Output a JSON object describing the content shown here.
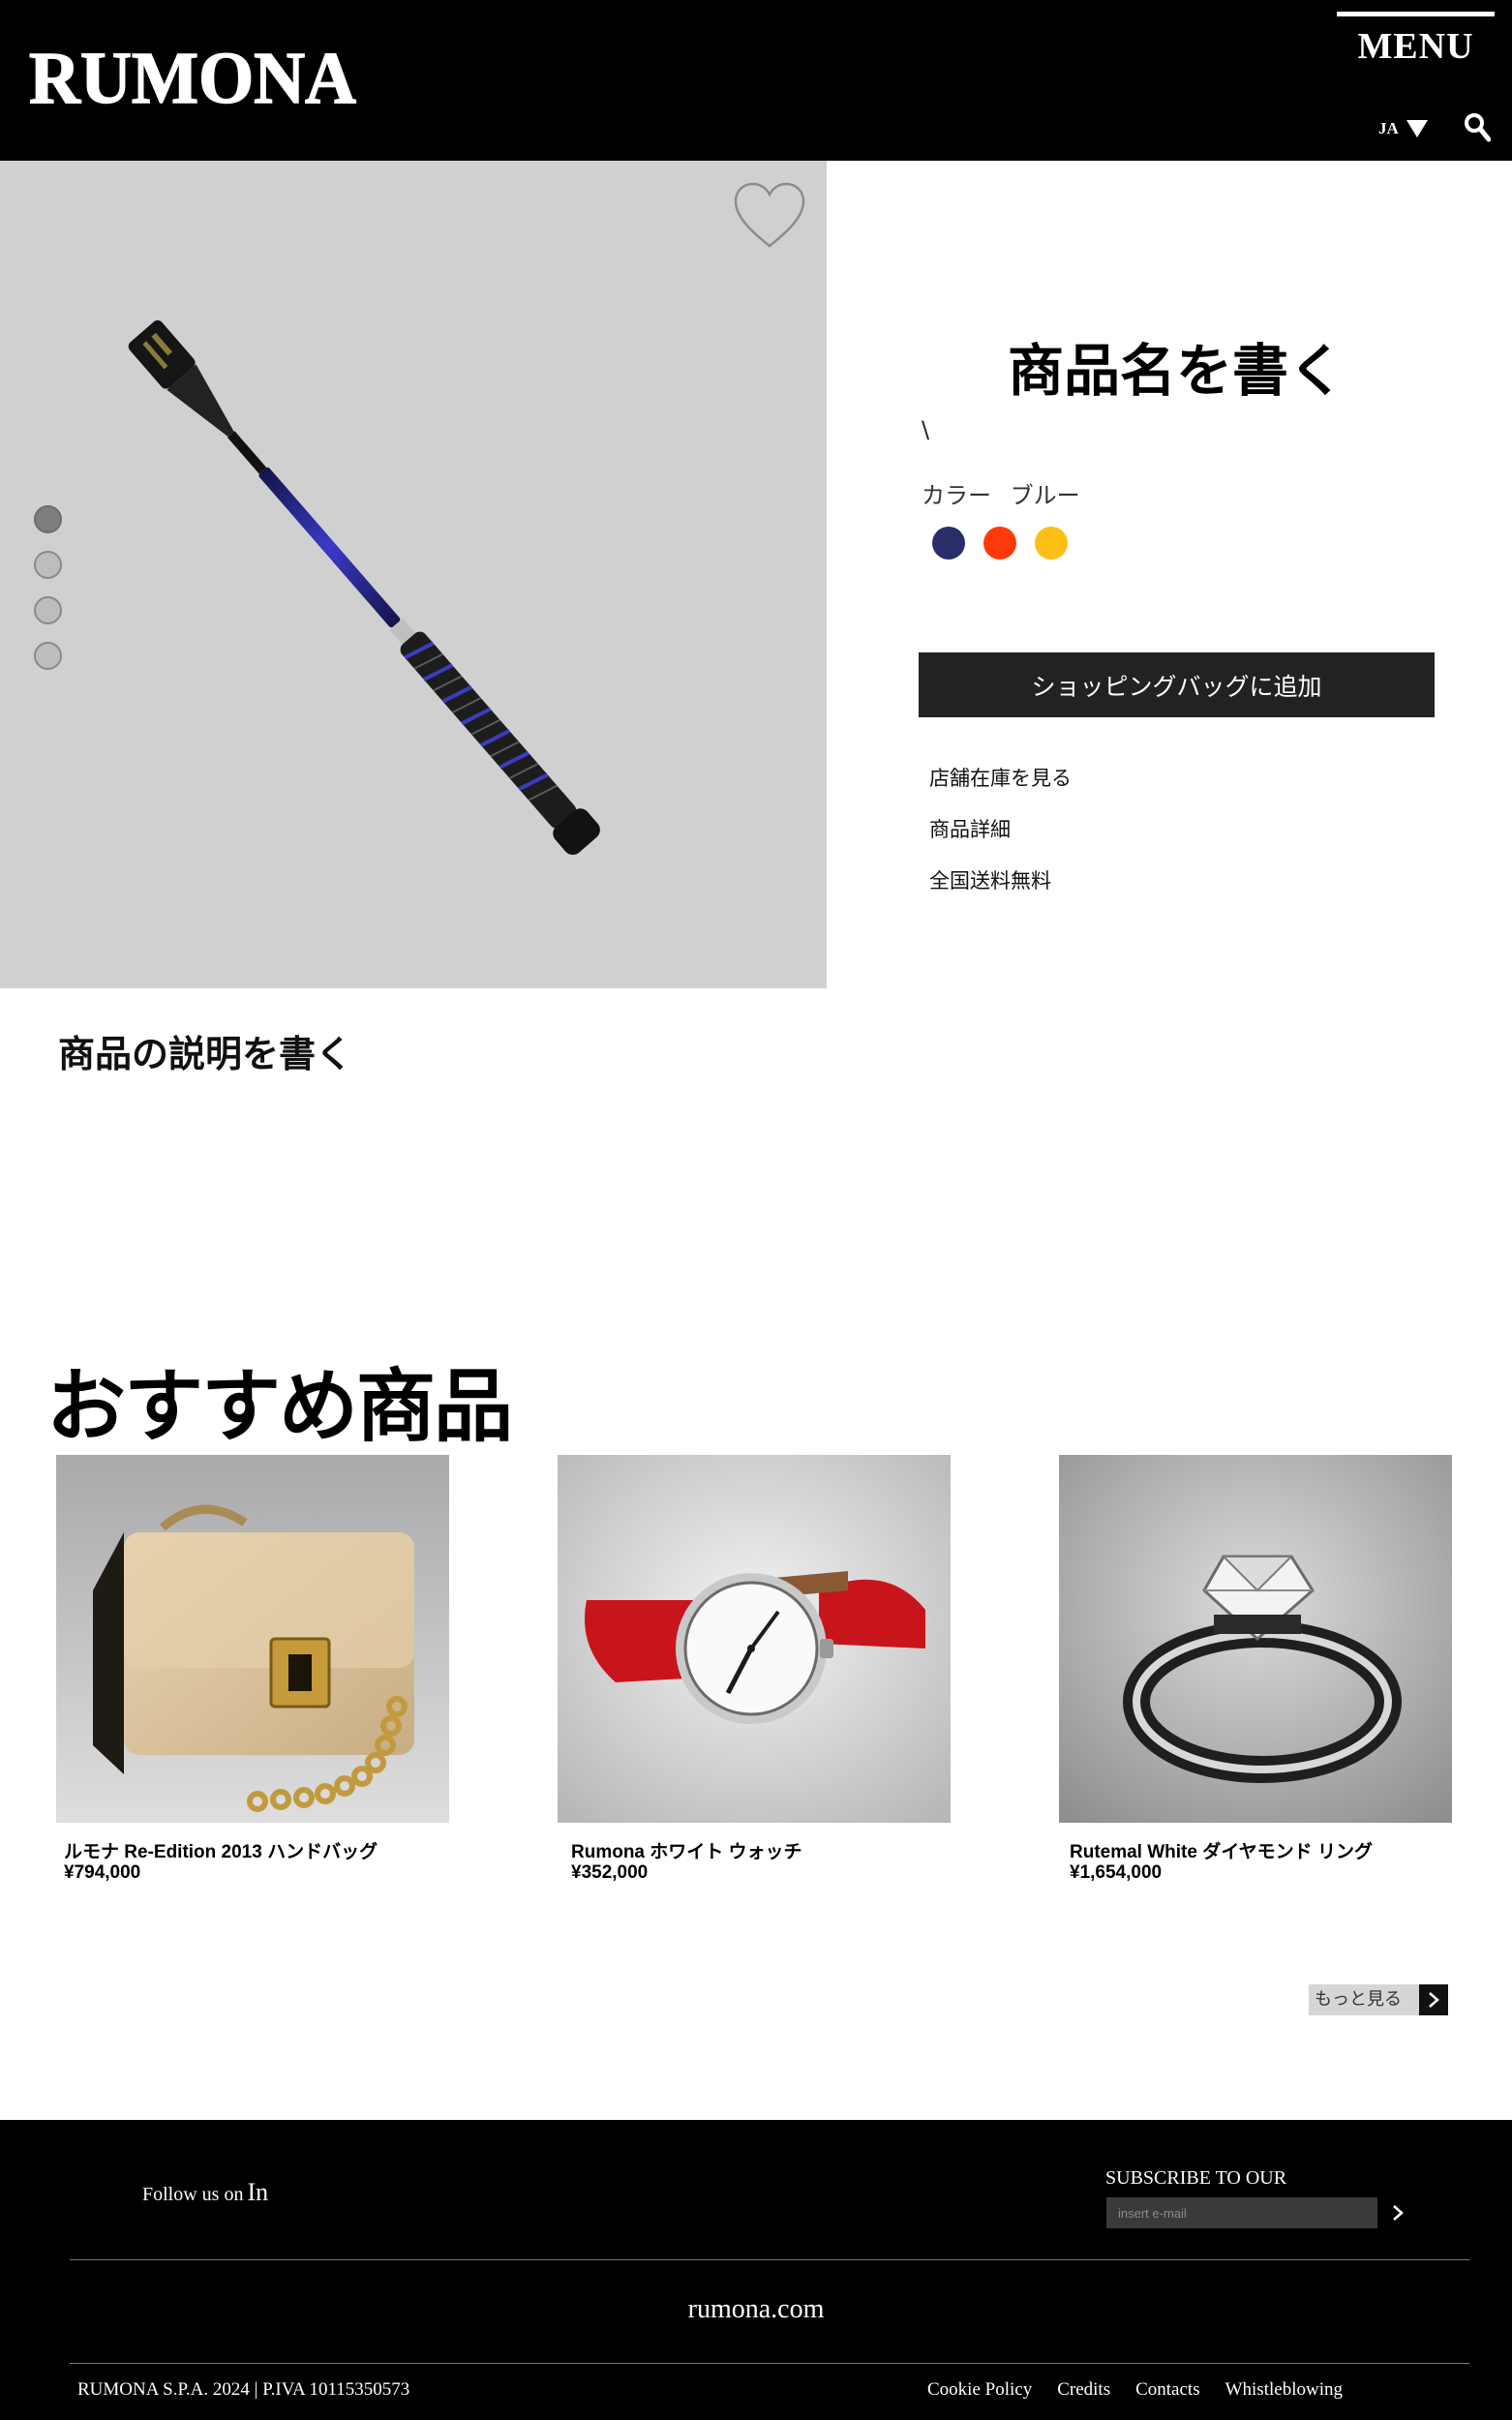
{
  "header": {
    "brand": "RUMONA",
    "menu_label": "MENU",
    "language": "JA",
    "icons": {
      "language_arrow": "caret-down-icon",
      "search": "search-icon"
    }
  },
  "gallery": {
    "favorite_icon": "heart-icon",
    "image_count": 4,
    "active_image": 1,
    "background": "#d0d0d0"
  },
  "product": {
    "name": "商品名を書く",
    "subtitle_mark": "\\",
    "color_label": "カラー",
    "color_value": "ブルー",
    "swatches": [
      {
        "name": "navy",
        "hex": "#2b2d6a"
      },
      {
        "name": "red-orange",
        "hex": "#ff3a0a"
      },
      {
        "name": "yellow",
        "hex": "#fcbf15"
      }
    ],
    "add_to_bag": "ショッピングバッグに追加",
    "links": [
      "店舗在庫を見る",
      "商品詳細",
      "全国送料無料"
    ],
    "description": "商品の説明を書く"
  },
  "recommended": {
    "title": "おすすめ商品",
    "items": [
      {
        "name": "ルモナ Re-Edition 2013 ハンドバッグ",
        "price": "¥794,000"
      },
      {
        "name": "Rumona ホワイト ウォッチ",
        "price": "¥352,000"
      },
      {
        "name": "Rutemal White ダイヤモンド リング",
        "price": "¥1,654,000"
      }
    ],
    "more_label": "もっと見る"
  },
  "footer": {
    "follow_text": "Follow us on",
    "follow_network": "In",
    "subscribe": "SUBSCRIBE TO OUR NEWSLETTER",
    "email_placeholder": "insert e-mail",
    "site": "rumona.com",
    "copyright": "RUMONA S.P.A. 2024 | P.IVA 10115350573",
    "links": [
      "Cookie Policy",
      "Credits",
      "Contacts",
      "Whistleblowing"
    ]
  }
}
